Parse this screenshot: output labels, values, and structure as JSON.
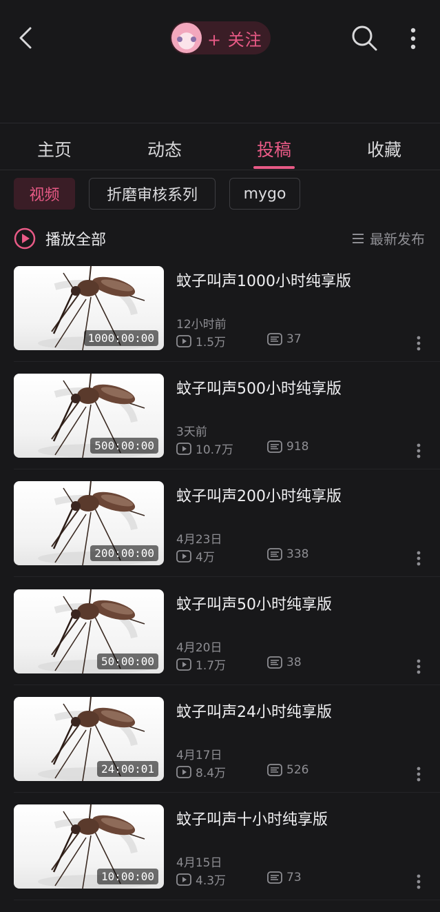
{
  "header": {
    "follow_label": "+ 关注"
  },
  "tabs": [
    {
      "label": "主页"
    },
    {
      "label": "动态"
    },
    {
      "label": "投稿"
    },
    {
      "label": "收藏"
    }
  ],
  "filters": [
    {
      "label": "视频"
    },
    {
      "label": "折磨审核系列"
    },
    {
      "label": "mygo"
    }
  ],
  "play_all_label": "播放全部",
  "sort_label": "最新发布",
  "colors": {
    "accent": "#e85a86",
    "background": "#18181a"
  },
  "videos": [
    {
      "title": "蚊子叫声1000小时纯享版",
      "duration": "1000:00:00",
      "date": "12小时前",
      "views": "1.5万",
      "comments": "37"
    },
    {
      "title": "蚊子叫声500小时纯享版",
      "duration": "500:00:00",
      "date": "3天前",
      "views": "10.7万",
      "comments": "918"
    },
    {
      "title": "蚊子叫声200小时纯享版",
      "duration": "200:00:00",
      "date": "4月23日",
      "views": "4万",
      "comments": "338"
    },
    {
      "title": "蚊子叫声50小时纯享版",
      "duration": "50:00:00",
      "date": "4月20日",
      "views": "1.7万",
      "comments": "38"
    },
    {
      "title": "蚊子叫声24小时纯享版",
      "duration": "24:00:01",
      "date": "4月17日",
      "views": "8.4万",
      "comments": "526"
    },
    {
      "title": "蚊子叫声十小时纯享版",
      "duration": "10:00:00",
      "date": "4月15日",
      "views": "4.3万",
      "comments": "73"
    }
  ]
}
